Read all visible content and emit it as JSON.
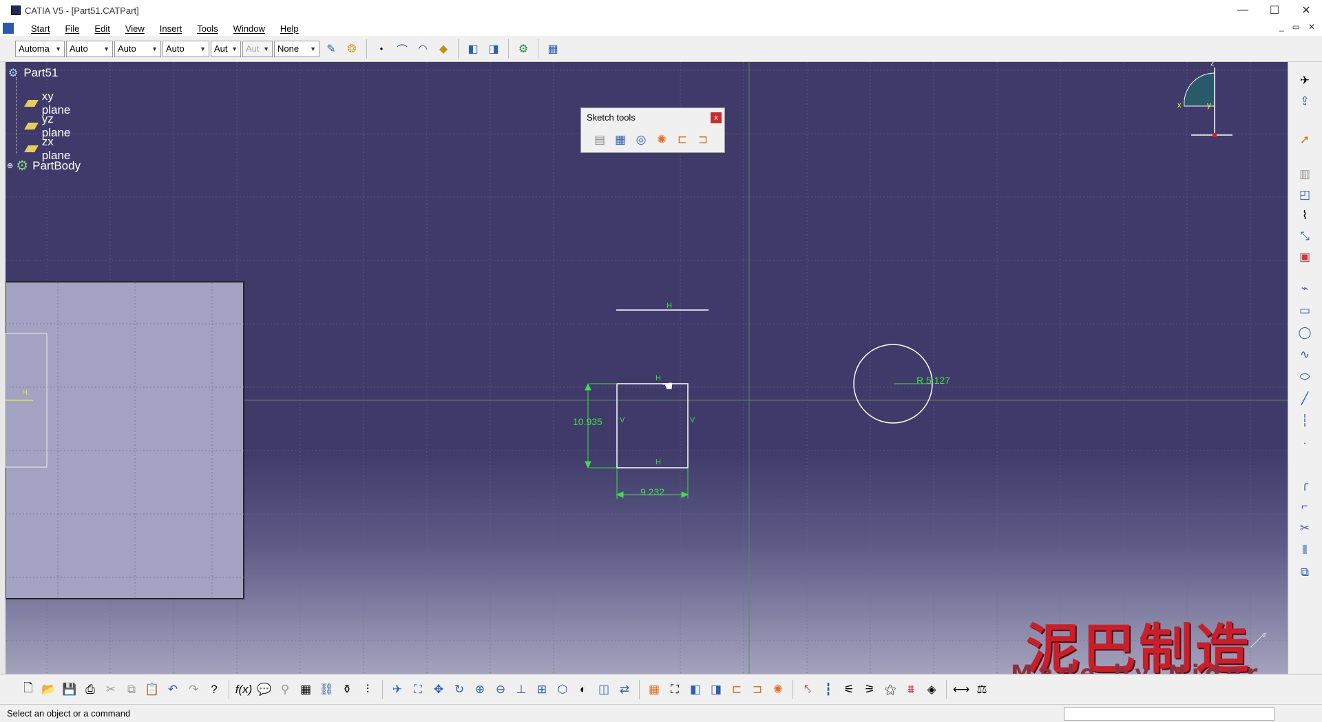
{
  "window": {
    "title": "CATIA V5 - [Part51.CATPart]",
    "min": "—",
    "max": "☐",
    "close": "✕"
  },
  "menubar": {
    "items": [
      "Start",
      "File",
      "Edit",
      "View",
      "Insert",
      "Tools",
      "Window",
      "Help"
    ],
    "mdi": [
      "_",
      "▭",
      "✕"
    ]
  },
  "toolbar": {
    "combos": [
      {
        "value": "Automa"
      },
      {
        "value": "Auto"
      },
      {
        "value": "Auto"
      },
      {
        "value": "Auto"
      },
      {
        "value": "Aut"
      },
      {
        "value": "Aut",
        "disabled": true
      },
      {
        "value": "None"
      }
    ]
  },
  "tree": {
    "root": "Part51",
    "planes": [
      "xy plane",
      "yz plane",
      "zx plane"
    ],
    "body": "PartBody"
  },
  "sketch_tools": {
    "title": "Sketch tools",
    "close": "x"
  },
  "sketch": {
    "dim_height": "10.935",
    "dim_width": "9.232",
    "dim_radius": "R 5.127",
    "h": "H",
    "v": "V"
  },
  "compass": {
    "x": "x",
    "y": "y",
    "z": "z"
  },
  "axis_corner": "z",
  "watermark": {
    "cn": "泥巴制造",
    "en": "Made by Nider"
  },
  "status": {
    "message": "Select an object or a command"
  },
  "colors": {
    "viewport_top": "#3f3a69",
    "viewport_bottom": "#a4a3bd",
    "sketch_green": "#3ce048",
    "watermark_red": "#c8202a"
  }
}
